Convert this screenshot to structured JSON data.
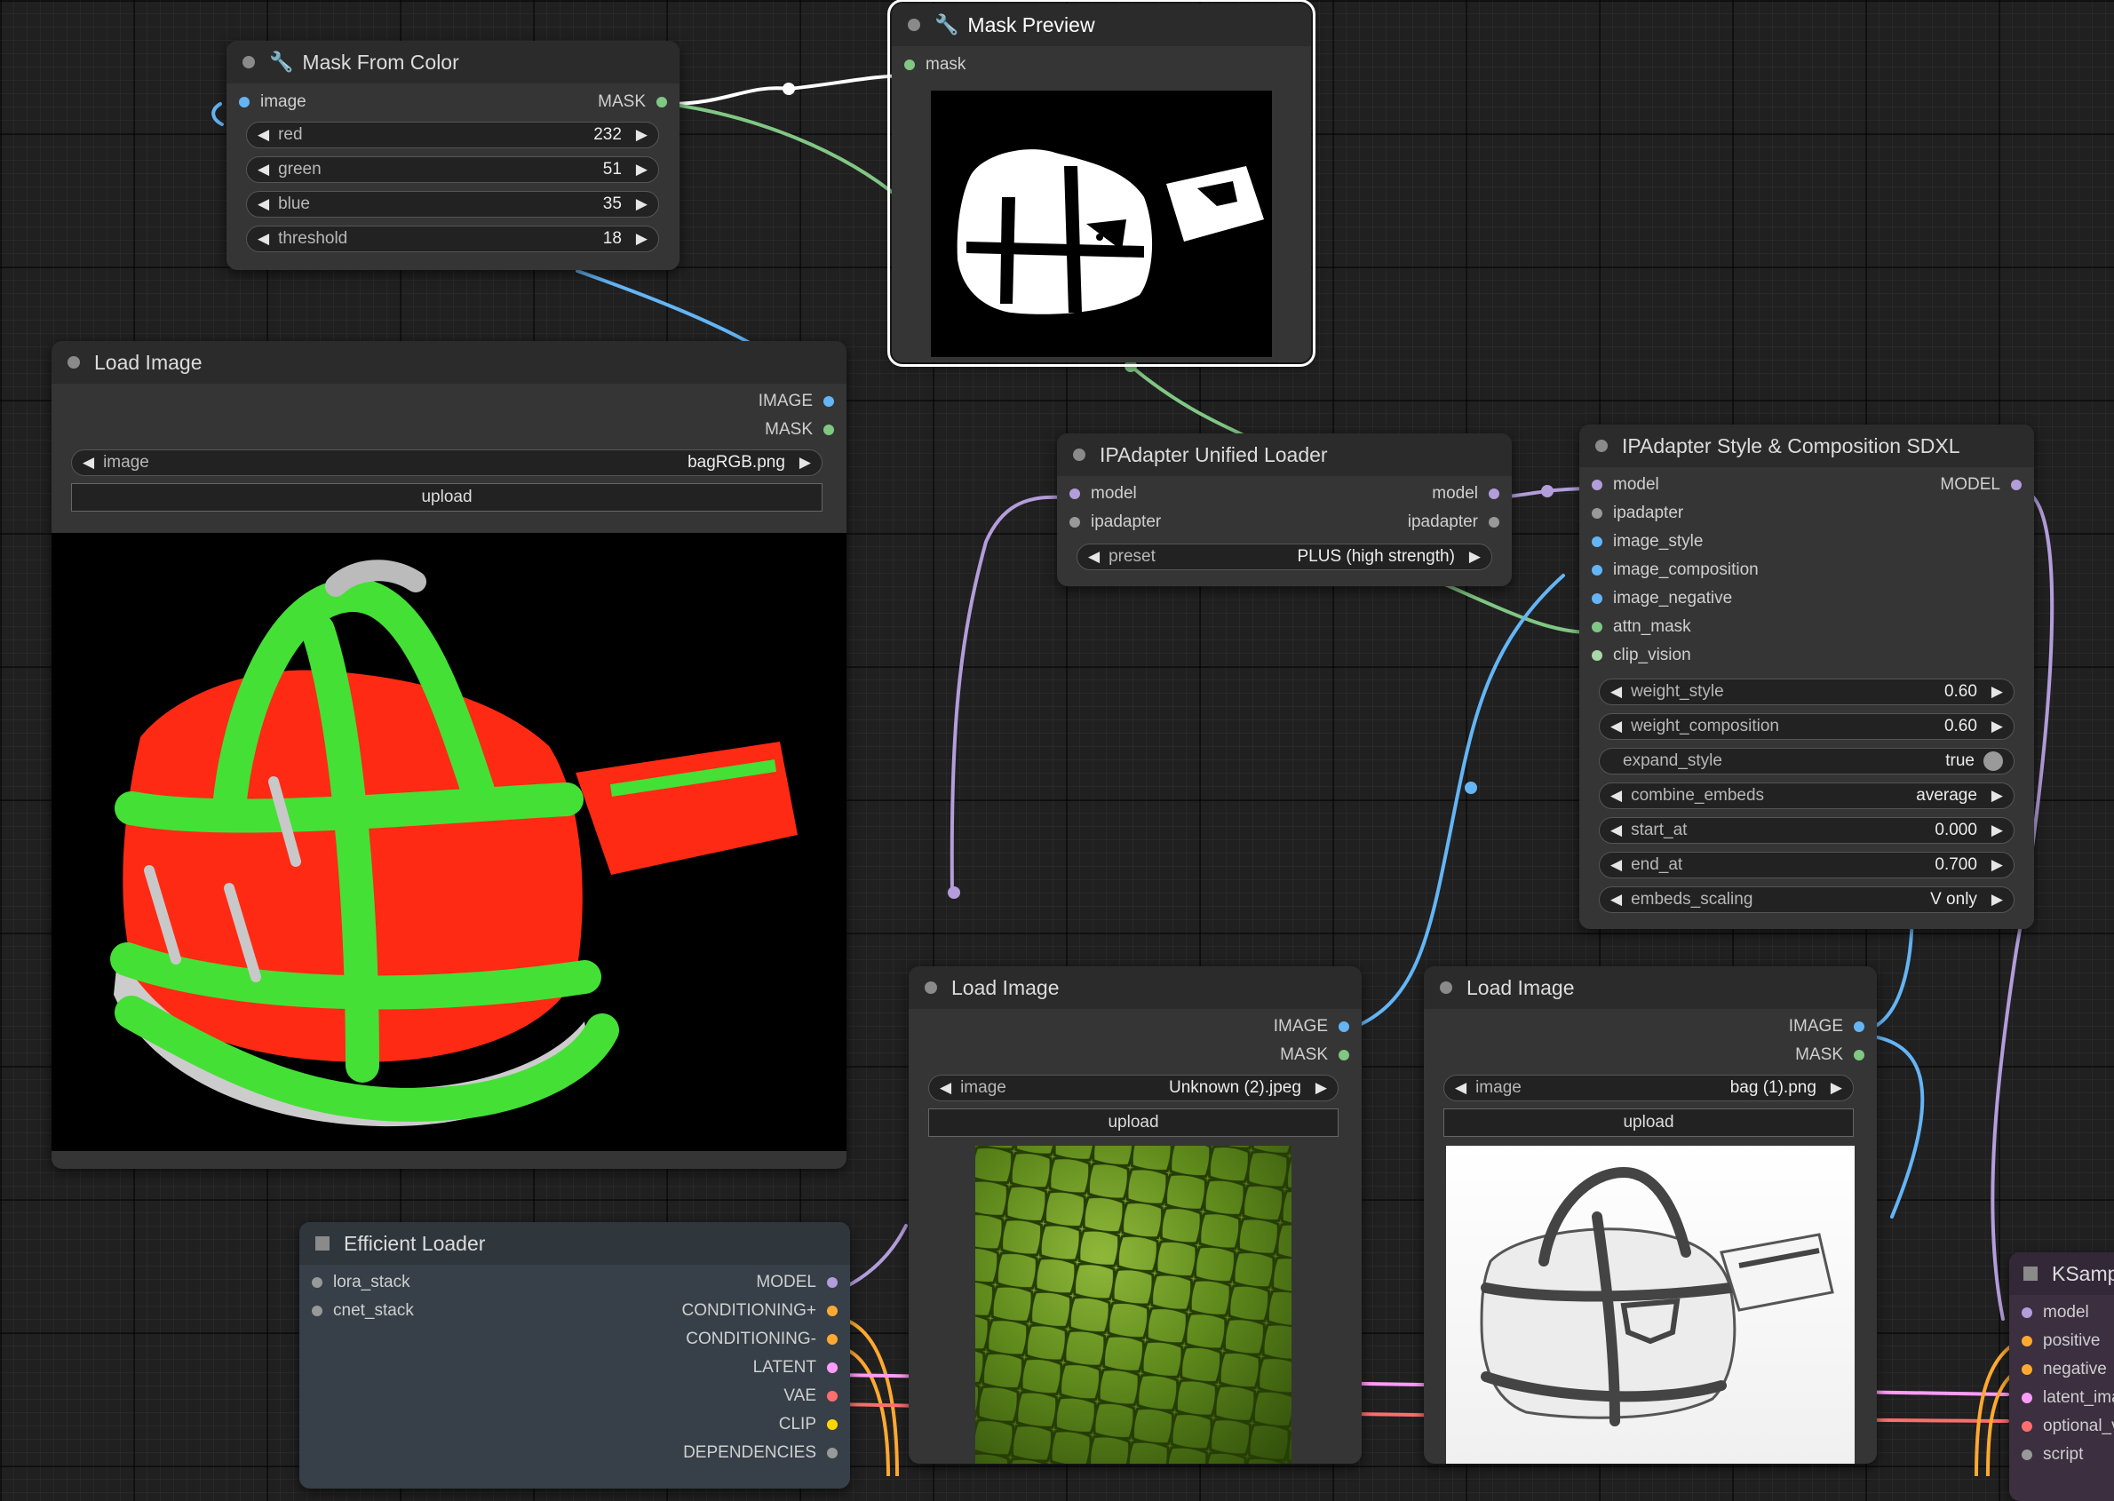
{
  "colors": {
    "image": "#64b5f6",
    "mask": "#81c784",
    "model": "#b39ddb",
    "generic": "#999999",
    "conditioning": "#ffa931",
    "latent": "#ff9cf9",
    "vae": "#ff6e6e",
    "clip": "#ffd500"
  },
  "mask_from_color": {
    "title": "Mask From Color",
    "input": "image",
    "output": "MASK",
    "widgets": [
      {
        "label": "red",
        "value": "232"
      },
      {
        "label": "green",
        "value": "51"
      },
      {
        "label": "blue",
        "value": "35"
      },
      {
        "label": "threshold",
        "value": "18"
      }
    ]
  },
  "mask_preview": {
    "title": "Mask Preview",
    "input": "mask"
  },
  "load_image_1": {
    "title": "Load Image",
    "outputs": [
      "IMAGE",
      "MASK"
    ],
    "widget_label": "image",
    "filename": "bagRGB.png",
    "upload": "upload"
  },
  "ipadapter_loader": {
    "title": "IPAdapter Unified Loader",
    "inputs": [
      "model",
      "ipadapter"
    ],
    "outputs": [
      "model",
      "ipadapter"
    ],
    "preset_label": "preset",
    "preset_value": "PLUS (high strength)"
  },
  "ipadapter_style": {
    "title": "IPAdapter Style & Composition SDXL",
    "inputs": [
      "model",
      "ipadapter",
      "image_style",
      "image_composition",
      "image_negative",
      "attn_mask",
      "clip_vision"
    ],
    "output": "MODEL",
    "widgets": [
      {
        "label": "weight_style",
        "value": "0.60"
      },
      {
        "label": "weight_composition",
        "value": "0.60"
      },
      {
        "label": "expand_style",
        "value": "true"
      },
      {
        "label": "combine_embeds",
        "value": "average"
      },
      {
        "label": "start_at",
        "value": "0.000"
      },
      {
        "label": "end_at",
        "value": "0.700"
      },
      {
        "label": "embeds_scaling",
        "value": "V only"
      }
    ]
  },
  "load_image_2": {
    "title": "Load Image",
    "outputs": [
      "IMAGE",
      "MASK"
    ],
    "widget_label": "image",
    "filename": "Unknown (2).jpeg",
    "upload": "upload"
  },
  "load_image_3": {
    "title": "Load Image",
    "outputs": [
      "IMAGE",
      "MASK"
    ],
    "widget_label": "image",
    "filename": "bag (1).png",
    "upload": "upload"
  },
  "efficient_loader": {
    "title": "Efficient Loader",
    "inputs": [
      "lora_stack",
      "cnet_stack"
    ],
    "outputs": [
      "MODEL",
      "CONDITIONING+",
      "CONDITIONING-",
      "LATENT",
      "VAE",
      "CLIP",
      "DEPENDENCIES"
    ]
  },
  "ksampler": {
    "title": "KSamp",
    "inputs": [
      "model",
      "positive",
      "negative",
      "latent_ima",
      "optional_v",
      "script"
    ]
  },
  "icons": {
    "wrench": "wrench-icon",
    "left_arrow": "left-arrow-icon",
    "right_arrow": "right-arrow-icon"
  }
}
